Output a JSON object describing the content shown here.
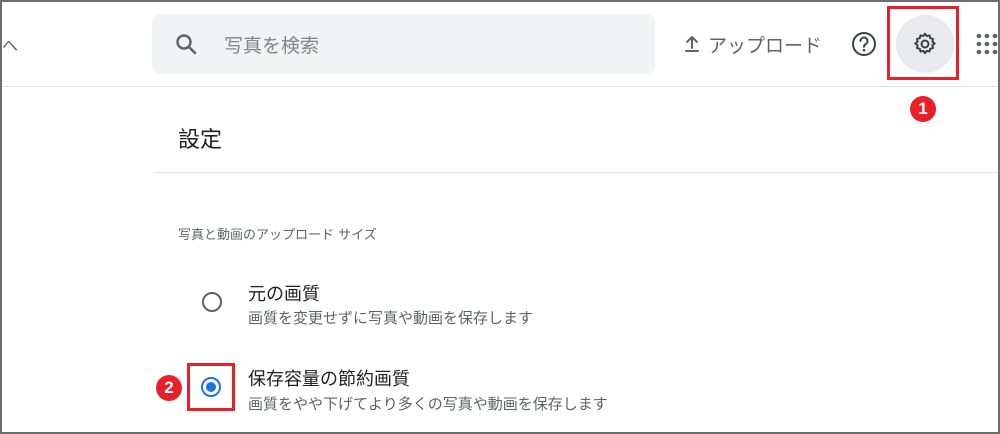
{
  "topbar": {
    "corner_glyph": "へ",
    "search": {
      "placeholder": "写真を検索",
      "icon": "search-icon"
    },
    "upload": {
      "label": "アップロード",
      "icon": "upload-icon"
    },
    "help_icon": "help-circle-icon",
    "settings_icon": "gear-icon",
    "apps_icon": "apps-grid-icon"
  },
  "settings": {
    "title": "設定",
    "section_label": "写真と動画のアップロード サイズ",
    "options": [
      {
        "title": "元の画質",
        "description": "画質を変更せずに写真や動画を保存します",
        "selected": false
      },
      {
        "title": "保存容量の節約画質",
        "description": "画質をやや下げてより多くの写真や動画を保存します",
        "selected": true
      }
    ]
  },
  "annotations": {
    "badge_1": "1",
    "badge_2": "2",
    "highlight_color": "#e8202a"
  },
  "colors": {
    "accent": "#1a73e8",
    "search_bg": "#f1f3f4",
    "gear_bg": "#e8eaed"
  }
}
